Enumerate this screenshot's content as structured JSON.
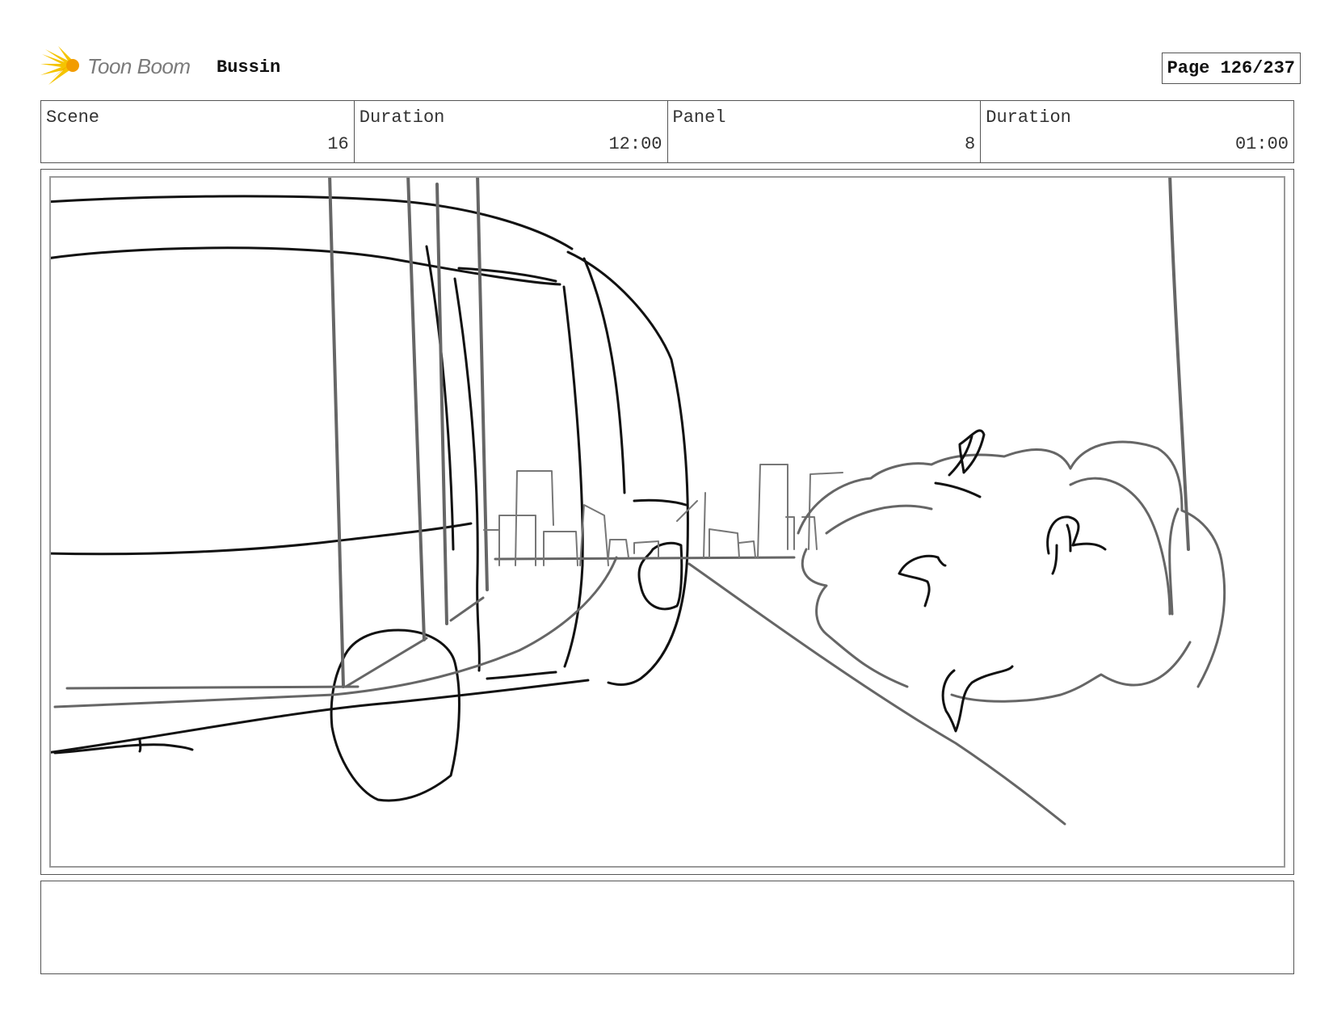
{
  "header": {
    "logo_text": "Toon Boom",
    "project_title": "Bussin",
    "page_label": "Page 126/237"
  },
  "info": [
    {
      "label": "Scene",
      "value": "16"
    },
    {
      "label": "Duration",
      "value": "12:00"
    },
    {
      "label": "Panel",
      "value": "8"
    },
    {
      "label": "Duration",
      "value": "01:00"
    }
  ],
  "colors": {
    "logo_yellow": "#f5c400",
    "logo_orange": "#f29c00",
    "sketch_black": "#111111",
    "sketch_grey": "#666666"
  },
  "notes": ""
}
